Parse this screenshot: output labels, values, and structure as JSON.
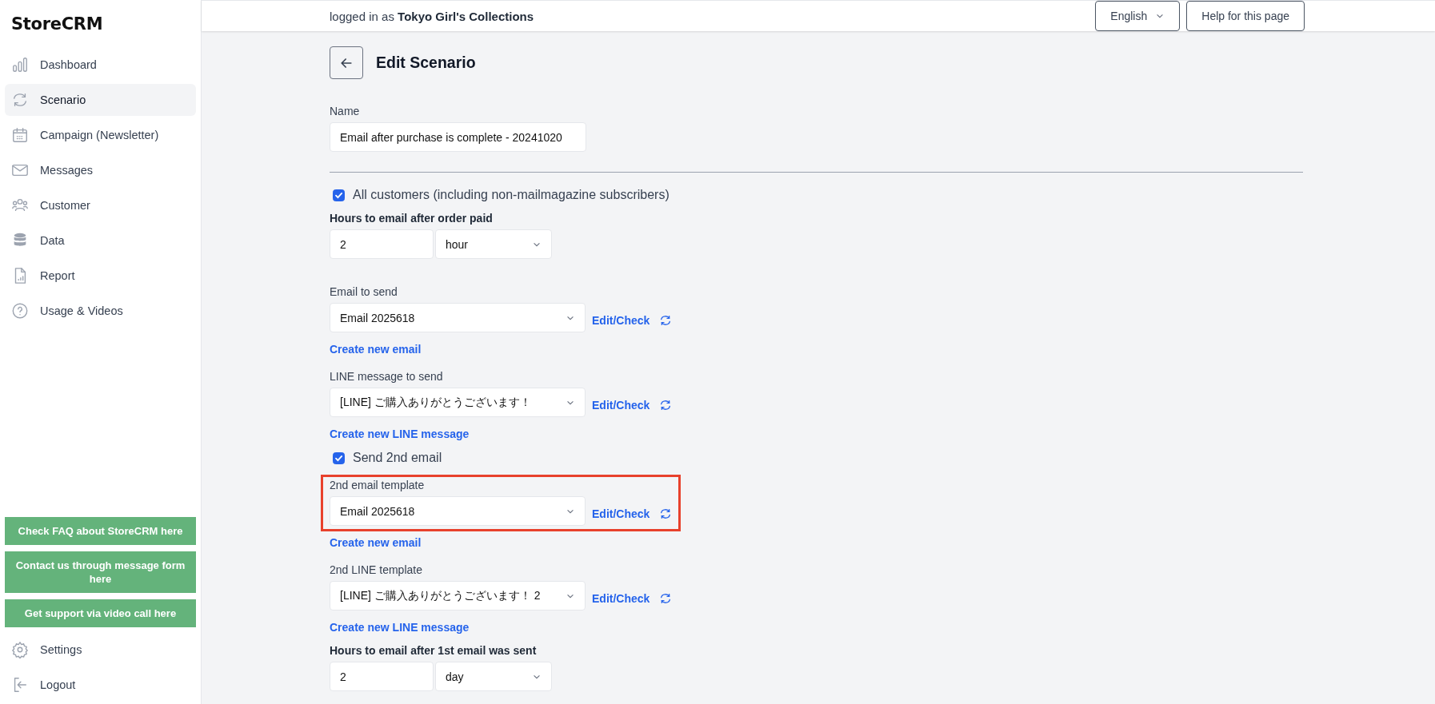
{
  "sidebar": {
    "logo": "StoreCRM",
    "items": [
      {
        "label": "Dashboard",
        "selected": false
      },
      {
        "label": "Scenario",
        "selected": true
      },
      {
        "label": "Campaign (Newsletter)",
        "selected": false
      },
      {
        "label": "Messages",
        "selected": false
      },
      {
        "label": "Customer",
        "selected": false
      },
      {
        "label": "Data",
        "selected": false
      },
      {
        "label": "Report",
        "selected": false
      },
      {
        "label": "Usage & Videos",
        "selected": false
      }
    ],
    "support_buttons": [
      "Check FAQ about StoreCRM here",
      "Contact us through message form here",
      "Get support via video call here"
    ],
    "bottom_items": [
      {
        "label": "Settings",
        "selected": false
      },
      {
        "label": "Logout",
        "selected": false
      }
    ]
  },
  "header": {
    "user": "logged in as **Tokyo Girl's Collections**",
    "language": "English",
    "help_button": "Help for this page"
  },
  "form": {
    "title": "Edit Scenario",
    "items": [
      {
        "kind": "text_input",
        "label": "Name",
        "value": "Email after purchase is complete - 20241020"
      },
      {
        "kind": "checkbox",
        "label": "All customers (including non-mailmagazine subscribers)",
        "checked": true
      },
      {
        "kind": "duration",
        "label": "Hours to email after order paid",
        "amount": "2",
        "unit": "hour"
      },
      {
        "kind": "template_select",
        "label": "Email to send",
        "value": "Email 2025618",
        "action": "Edit/Check",
        "create_link": "Create new email",
        "highlighted": false
      },
      {
        "kind": "template_select",
        "label": "LINE message to send",
        "value": "[LINE] ご購入ありがとうございます！",
        "action": "Edit/Check",
        "create_link": "Create new LINE message",
        "highlighted": false
      },
      {
        "kind": "checkbox",
        "label": "Send 2nd email",
        "checked": true
      },
      {
        "kind": "template_select",
        "label": "2nd email template",
        "value": "Email 2025618",
        "action": "Edit/Check",
        "create_link": "Create new email",
        "highlighted": true
      },
      {
        "kind": "template_select",
        "label": "2nd LINE template",
        "value": "[LINE] ご購入ありがとうございます！ 2",
        "action": "Edit/Check",
        "create_link": "Create new LINE message",
        "highlighted": false
      },
      {
        "kind": "duration",
        "label": "Hours to email after 1st email was sent",
        "amount": "2",
        "unit": "day"
      }
    ]
  }
}
